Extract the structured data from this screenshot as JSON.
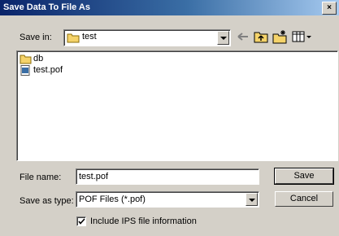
{
  "window": {
    "title": "Save Data To File As",
    "close_glyph": "×"
  },
  "toolbar": {
    "save_in_label": "Save in:",
    "save_in_value": "test",
    "icons": [
      "back-arrow-icon",
      "up-folder-icon",
      "new-folder-icon",
      "view-menu-icon"
    ]
  },
  "file_list": {
    "items": [
      {
        "name": "db",
        "kind": "folder"
      },
      {
        "name": "test.pof",
        "kind": "file"
      }
    ]
  },
  "form": {
    "file_name_label": "File name:",
    "file_name_value": "test.pof",
    "save_as_type_label": "Save as type:",
    "save_as_type_value": "POF Files (*.pof)",
    "save_button": "Save",
    "cancel_button": "Cancel",
    "include_ips_label": "Include IPS file information",
    "include_ips_checked": true
  },
  "colors": {
    "title_bar": "#0a246a",
    "face": "#d4d0c8",
    "folder": "#f5d36a"
  }
}
